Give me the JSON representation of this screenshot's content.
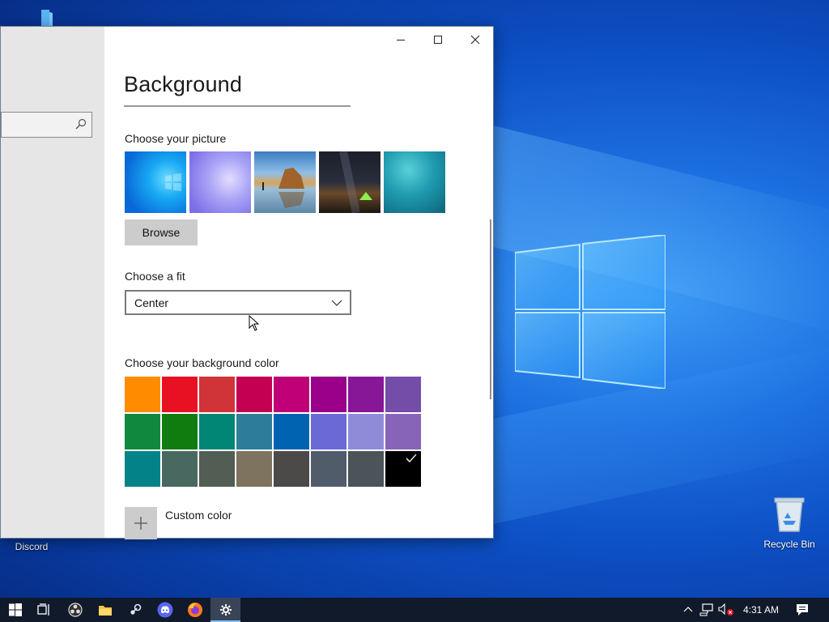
{
  "desktop": {
    "icons": [
      {
        "label": ""
      },
      {
        "label": "Discord"
      },
      {
        "label": "Recycle Bin"
      }
    ]
  },
  "window": {
    "title_buttons": [
      "minimize-icon",
      "maximize-icon",
      "close-icon"
    ],
    "page_title": "Background",
    "picture_section": {
      "label": "Choose your picture",
      "thumbnails": [
        {
          "name": "windows-blue-wallpaper",
          "colors": [
            "#0a9bf0",
            "#17c2ff",
            "#0756c9"
          ]
        },
        {
          "name": "windows-purple-wallpaper",
          "colors": [
            "#9aa5f5",
            "#c8b7f7",
            "#6f74e3"
          ]
        },
        {
          "name": "beach-rocks-wallpaper",
          "colors": [
            "#6aa7d9",
            "#c98d42",
            "#2a3b4d"
          ]
        },
        {
          "name": "night-sky-tent-wallpaper",
          "colors": [
            "#1d2330",
            "#3b3028",
            "#7fd94e"
          ]
        },
        {
          "name": "underwater-swimmer-wallpaper",
          "colors": [
            "#1b8aa0",
            "#39b3c2",
            "#0d5f73"
          ]
        }
      ],
      "browse_label": "Browse"
    },
    "fit_section": {
      "label": "Choose a fit",
      "selected": "Center"
    },
    "color_section": {
      "label": "Choose your background color",
      "swatches": [
        "#ff8c00",
        "#e81123",
        "#d13438",
        "#c30052",
        "#bf0077",
        "#9a0089",
        "#881798",
        "#744da9",
        "#10893e",
        "#107c10",
        "#018574",
        "#2d7d9a",
        "#0063b1",
        "#6b69d6",
        "#8e8cd8",
        "#8764b8",
        "#038387",
        "#486860",
        "#525e54",
        "#7e735f",
        "#4c4a48",
        "#515c6b",
        "#4a5459",
        "#000000"
      ],
      "selected_index": 23,
      "custom_label": "Custom color"
    }
  },
  "taskbar": {
    "apps": [
      "start-icon",
      "task-view-icon",
      "obs-icon",
      "file-explorer-icon",
      "steam-icon",
      "discord-icon",
      "firefox-icon",
      "settings-icon"
    ],
    "active_app": "settings-icon",
    "tray": [
      "chevron-up-icon",
      "network-icon",
      "volume-muted-icon"
    ],
    "clock": "4:31 AM",
    "notification": "action-center-icon"
  }
}
